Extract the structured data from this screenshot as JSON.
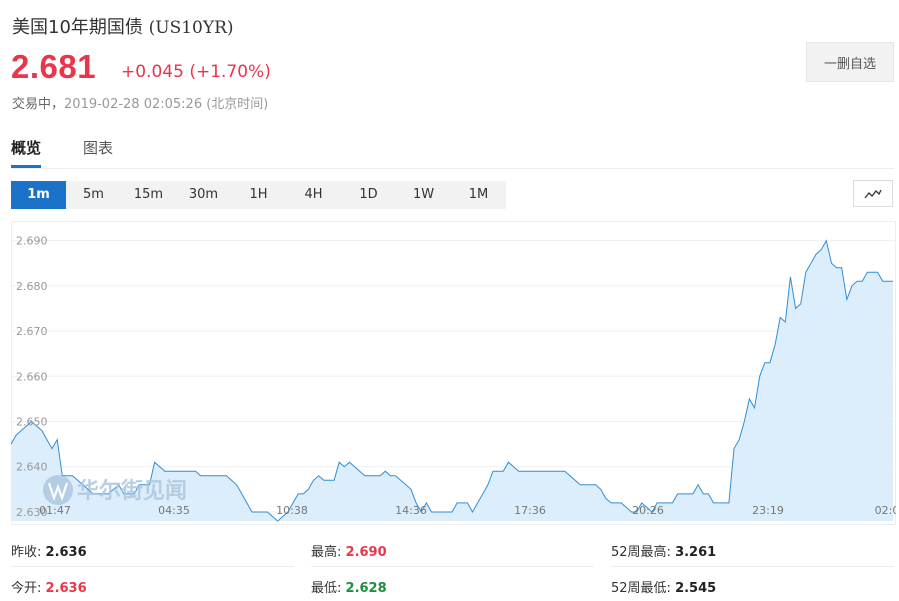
{
  "header": {
    "title": "美国10年期国债",
    "symbol": "(US10YR)",
    "price": "2.681",
    "change": "+0.045 (+1.70%)",
    "status": "交易中",
    "timestamp": "2019-02-28 02:05:26 (北京时间)",
    "watchlist_button": "一删自选"
  },
  "tabs": [
    {
      "label": "概览",
      "active": true
    },
    {
      "label": "图表",
      "active": false
    }
  ],
  "intervals": [
    "1m",
    "5m",
    "15m",
    "30m",
    "1H",
    "4H",
    "1D",
    "1W",
    "1M"
  ],
  "active_interval": "1m",
  "watermark": "华尔街见闻",
  "colors": {
    "up": "#e8364a",
    "down": "#1e8e3e",
    "accent": "#1a73c8",
    "line": "#2f8fd6",
    "area": "#dcedfb"
  },
  "chart_data": {
    "type": "area",
    "ylim": [
      2.628,
      2.693
    ],
    "yticks": [
      "2.690",
      "2.680",
      "2.670",
      "2.660",
      "2.650",
      "2.640",
      "2.630"
    ],
    "xticks": [
      "01:47",
      "04:35",
      "10:38",
      "14:36",
      "17:36",
      "20:26",
      "23:19",
      "02:0"
    ],
    "values": [
      2.645,
      2.647,
      2.648,
      2.649,
      2.65,
      2.649,
      2.648,
      2.646,
      2.644,
      2.646,
      2.638,
      2.638,
      2.638,
      2.637,
      2.636,
      2.635,
      2.634,
      2.634,
      2.634,
      2.634,
      2.635,
      2.636,
      2.634,
      2.634,
      2.634,
      2.636,
      2.636,
      2.636,
      2.641,
      2.64,
      2.639,
      2.639,
      2.639,
      2.639,
      2.639,
      2.639,
      2.639,
      2.638,
      2.638,
      2.638,
      2.638,
      2.638,
      2.638,
      2.637,
      2.636,
      2.634,
      2.632,
      2.63,
      2.63,
      2.63,
      2.63,
      2.629,
      2.628,
      2.629,
      2.63,
      2.632,
      2.634,
      2.634,
      2.635,
      2.637,
      2.638,
      2.637,
      2.637,
      2.637,
      2.641,
      2.64,
      2.641,
      2.64,
      2.639,
      2.638,
      2.638,
      2.638,
      2.638,
      2.639,
      2.638,
      2.638,
      2.637,
      2.636,
      2.635,
      2.632,
      2.63,
      2.632,
      2.63,
      2.63,
      2.63,
      2.63,
      2.63,
      2.632,
      2.632,
      2.632,
      2.63,
      2.632,
      2.634,
      2.636,
      2.639,
      2.639,
      2.639,
      2.641,
      2.64,
      2.639,
      2.639,
      2.639,
      2.639,
      2.639,
      2.639,
      2.639,
      2.639,
      2.639,
      2.639,
      2.638,
      2.637,
      2.636,
      2.636,
      2.636,
      2.636,
      2.635,
      2.633,
      2.632,
      2.632,
      2.632,
      2.631,
      2.63,
      2.63,
      2.632,
      2.631,
      2.63,
      2.632,
      2.632,
      2.632,
      2.632,
      2.634,
      2.634,
      2.634,
      2.634,
      2.636,
      2.634,
      2.634,
      2.632,
      2.632,
      2.632,
      2.632,
      2.644,
      2.646,
      2.65,
      2.655,
      2.653,
      2.66,
      2.663,
      2.663,
      2.667,
      2.673,
      2.672,
      2.682,
      2.675,
      2.676,
      2.683,
      2.685,
      2.687,
      2.688,
      2.69,
      2.685,
      2.684,
      2.684,
      2.677,
      2.68,
      2.681,
      2.681,
      2.683,
      2.683,
      2.683,
      2.681,
      2.681,
      2.681
    ]
  },
  "stats": [
    {
      "label": "昨收:",
      "value": "2.636",
      "tone": "dark"
    },
    {
      "label": "最高:",
      "value": "2.690",
      "tone": "red"
    },
    {
      "label": "52周最高:",
      "value": "3.261",
      "tone": "dark"
    },
    {
      "label": "今开:",
      "value": "2.636",
      "tone": "red"
    },
    {
      "label": "最低:",
      "value": "2.628",
      "tone": "green"
    },
    {
      "label": "52周最低:",
      "value": "2.545",
      "tone": "dark"
    }
  ]
}
